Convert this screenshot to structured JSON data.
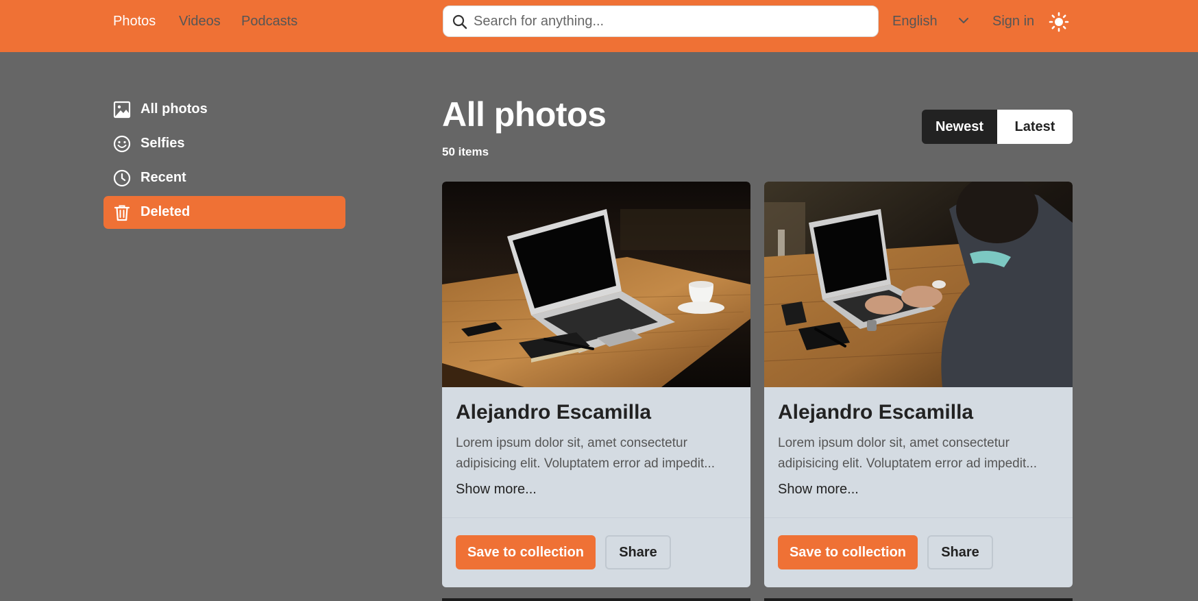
{
  "topnav": {
    "links": [
      "Photos",
      "Videos",
      "Podcasts"
    ],
    "active": "Photos",
    "search_placeholder": "Search for anything...",
    "language": "English",
    "signin": "Sign in",
    "theme_icon": "sun-icon"
  },
  "sidebar": {
    "items": [
      {
        "label": "All photos",
        "icon": "image-icon"
      },
      {
        "label": "Selfies",
        "icon": "smile-icon"
      },
      {
        "label": "Recent",
        "icon": "clock-icon"
      },
      {
        "label": "Deleted",
        "icon": "trash-icon",
        "active": true
      }
    ]
  },
  "main": {
    "title": "All photos",
    "count": "50 items",
    "sort": {
      "newest": "Newest",
      "latest": "Latest",
      "selected": "Newest"
    }
  },
  "cards": [
    {
      "title": "Alejandro Escamilla",
      "description": "Lorem ipsum dolor sit, amet consectetur adipisicing elit. Voluptatem error ad impedit...",
      "more": "Show more...",
      "save": "Save to collection",
      "share": "Share",
      "image": "laptop-on-table-photo"
    },
    {
      "title": "Alejandro Escamilla",
      "description": "Lorem ipsum dolor sit, amet consectetur adipisicing elit. Voluptatem error ad impedit...",
      "more": "Show more...",
      "save": "Save to collection",
      "share": "Share",
      "image": "person-typing-on-laptop-photo"
    }
  ],
  "colors": {
    "accent": "#ef7135",
    "background": "#666666",
    "card": "#d4dbe2",
    "dark": "#222222"
  }
}
